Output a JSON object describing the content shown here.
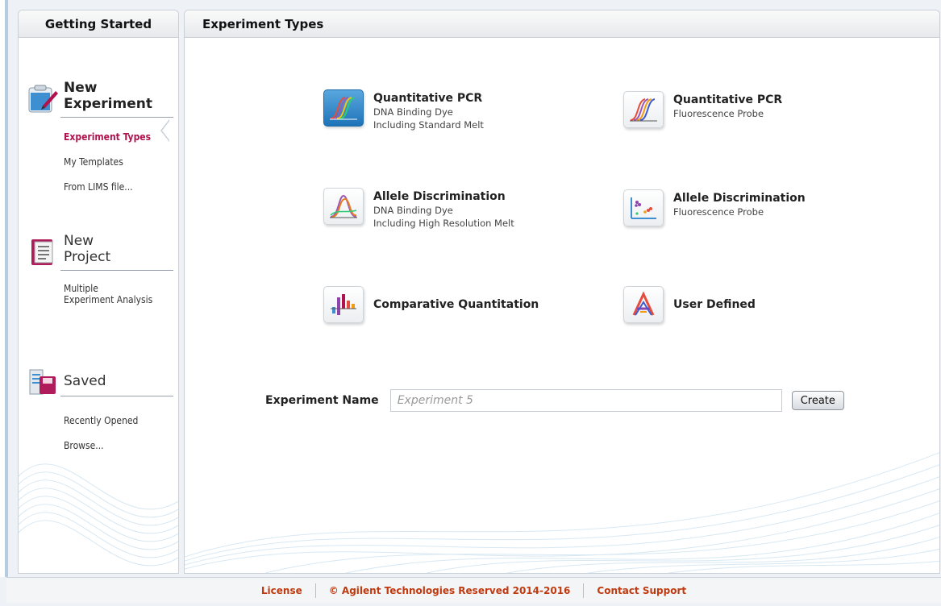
{
  "sidebar": {
    "header": "Getting Started",
    "sections": [
      {
        "title_line1": "New",
        "title_line2": "Experiment",
        "icon": "clipboard-pen-icon",
        "links": [
          "Experiment Types",
          "My Templates",
          "From LIMS file..."
        ]
      },
      {
        "title_line1": "New",
        "title_line2": "Project",
        "icon": "notebook-icon",
        "links_multi_line1": "Multiple",
        "links_multi_line2": "Experiment Analysis"
      },
      {
        "title_line1": "Saved",
        "icon": "saved-docs-icon",
        "links": [
          "Recently Opened",
          "Browse..."
        ]
      }
    ]
  },
  "main": {
    "header": "Experiment Types",
    "tiles": [
      {
        "title": "Quantitative PCR",
        "sub1": "DNA Binding Dye",
        "sub2": "Including Standard Melt",
        "icon": "amplification-curves-icon"
      },
      {
        "title": "Quantitative PCR",
        "sub1": "Fluorescence Probe",
        "sub2": "",
        "icon": "amplification-curves-icon"
      },
      {
        "title": "Allele Discrimination",
        "sub1": "DNA Binding Dye",
        "sub2": "Including High Resolution Melt",
        "icon": "melt-curve-icon"
      },
      {
        "title": "Allele Discrimination",
        "sub1": "Fluorescence Probe",
        "sub2": "",
        "icon": "scatter-plot-icon"
      },
      {
        "title": "Comparative Quantitation",
        "sub1": "",
        "sub2": "",
        "icon": "bar-chart-icon"
      },
      {
        "title": "User Defined",
        "sub1": "",
        "sub2": "",
        "icon": "user-defined-icon"
      }
    ],
    "experiment_name_label": "Experiment Name",
    "experiment_name_placeholder": "Experiment 5",
    "create_label": "Create"
  },
  "footer": {
    "license": "License",
    "copyright": "© Agilent Technologies Reserved 2014-2016",
    "support": "Contact Support"
  },
  "colors": {
    "active_link": "#b0124e",
    "footer_link": "#c03a10",
    "selected_tile": "#1e73b8"
  }
}
